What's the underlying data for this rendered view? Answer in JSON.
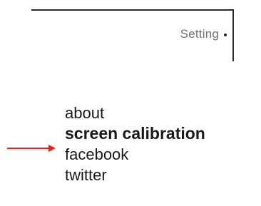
{
  "header": {
    "setting_label": "Setting"
  },
  "menu": {
    "items": [
      {
        "label": "about",
        "active": false
      },
      {
        "label": "screen calibration",
        "active": true
      },
      {
        "label": "facebook",
        "active": false
      },
      {
        "label": "twitter",
        "active": false
      }
    ]
  },
  "colors": {
    "arrow": "#e8231e",
    "frame": "#2b2b2b",
    "setting_text": "#707070",
    "menu_text": "#1a1a1a"
  },
  "icons": {
    "indicator": "right-arrow-icon",
    "setting_marker": "bullet-dot-icon"
  }
}
